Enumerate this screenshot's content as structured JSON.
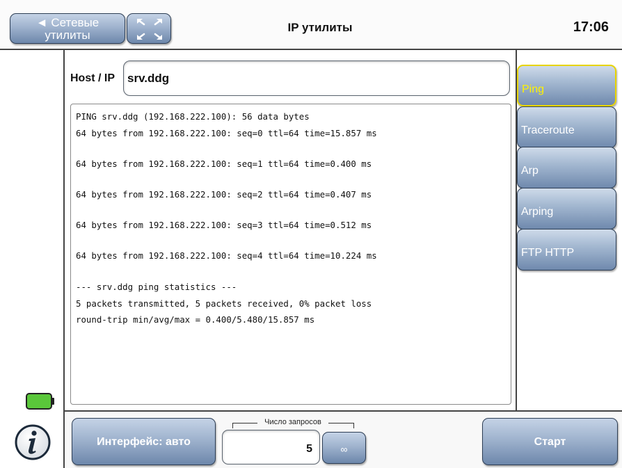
{
  "header": {
    "back_button": {
      "arrow": "◄",
      "line1": "Сетевые",
      "line2": "утилиты"
    },
    "fullscreen_icon": "expand-arrows-icon",
    "title": "IP утилиты",
    "clock": "17:06"
  },
  "host": {
    "label": "Host / IP",
    "value": "srv.ddg"
  },
  "output_lines": [
    "PING srv.ddg (192.168.222.100): 56 data bytes",
    "64 bytes from 192.168.222.100: seq=0 ttl=64 time=15.857 ms",
    "64 bytes from 192.168.222.100: seq=1 ttl=64 time=0.400 ms",
    "64 bytes from 192.168.222.100: seq=2 ttl=64 time=0.407 ms",
    "64 bytes from 192.168.222.100: seq=3 ttl=64 time=0.512 ms",
    "64 bytes from 192.168.222.100: seq=4 ttl=64 time=10.224 ms",
    "--- srv.ddg ping statistics ---",
    "5 packets transmitted, 5 packets received, 0% packet loss",
    "round-trip min/avg/max = 0.400/5.480/15.857 ms"
  ],
  "tabs": [
    {
      "label": "Ping",
      "active": true
    },
    {
      "label": "Traceroute",
      "active": false
    },
    {
      "label": "Arp",
      "active": false
    },
    {
      "label": "Arping",
      "active": false
    },
    {
      "label": "FTP HTTP",
      "active": false
    }
  ],
  "bottom": {
    "interface_button": "Интерфейс: авто",
    "count_label": "Число запросов",
    "count_value": "5",
    "infinity_button": "∞",
    "start_button": "Старт"
  },
  "status": {
    "battery_icon": "battery-icon",
    "battery_color": "#5ac73a",
    "info_icon": "info-icon"
  },
  "colors": {
    "button_top": "#c5d3e6",
    "button_bottom": "#6d87ab",
    "active_tab_text": "#fff200"
  }
}
